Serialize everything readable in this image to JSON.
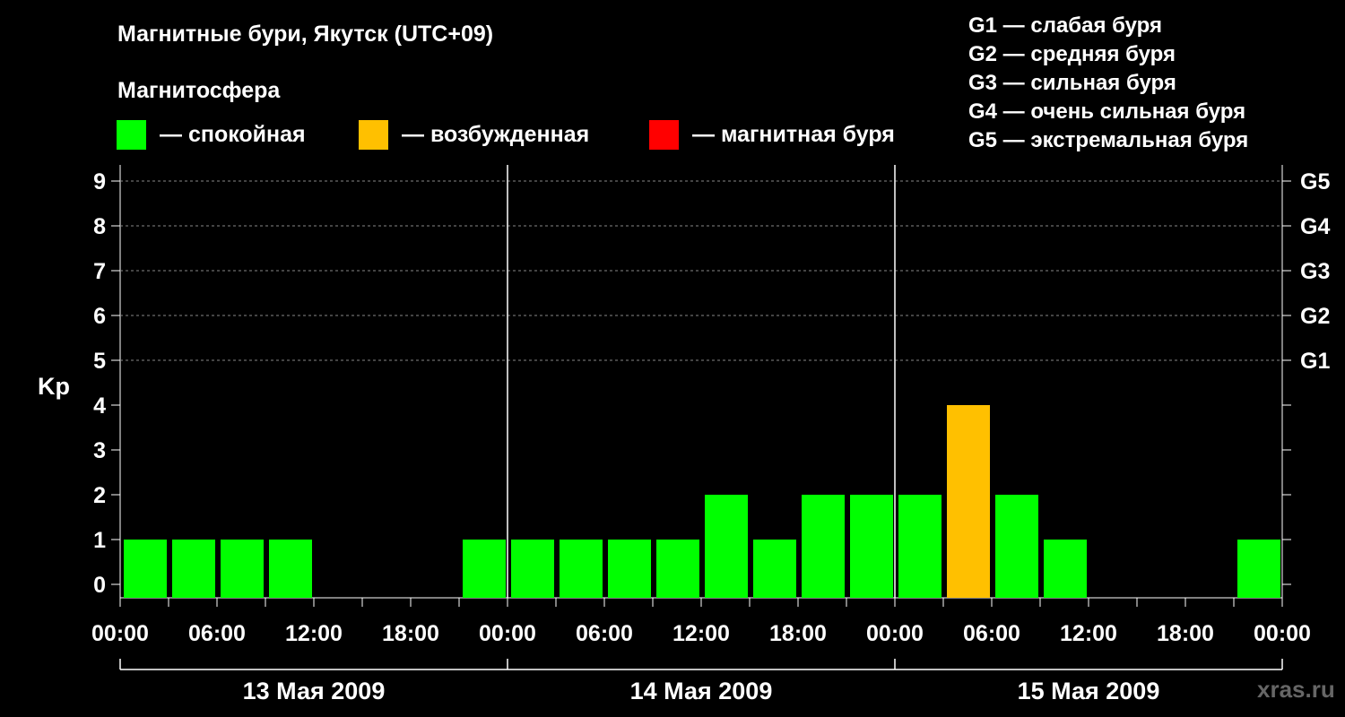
{
  "chart_data": {
    "type": "bar",
    "title": "Магнитные бури, Якутск (UTC+09)",
    "subtitle": "Магнитосфера",
    "ylabel": "Kp",
    "ylim": [
      0,
      9
    ],
    "y_ticks": [
      "0",
      "1",
      "2",
      "3",
      "4",
      "5",
      "6",
      "7",
      "8",
      "9"
    ],
    "g_ticks": [
      {
        "kp": 5,
        "label": "G1"
      },
      {
        "kp": 6,
        "label": "G2"
      },
      {
        "kp": 7,
        "label": "G3"
      },
      {
        "kp": 8,
        "label": "G4"
      },
      {
        "kp": 9,
        "label": "G5"
      }
    ],
    "x_tick_labels": [
      "00:00",
      "06:00",
      "12:00",
      "18:00",
      "00:00",
      "06:00",
      "12:00",
      "18:00",
      "00:00",
      "06:00",
      "12:00",
      "18:00",
      "00:00"
    ],
    "days": [
      "13 Мая 2009",
      "14 Мая 2009",
      "15 Мая 2009"
    ],
    "interval_hours": 3,
    "values": [
      1,
      1,
      1,
      1,
      0,
      0,
      0,
      1,
      1,
      1,
      1,
      1,
      2,
      1,
      2,
      2,
      2,
      4,
      2,
      1,
      0,
      0,
      0,
      1
    ],
    "grid": true,
    "legend": [
      {
        "label": "— спокойная",
        "color": "#00ff00"
      },
      {
        "label": "— возбужденная",
        "color": "#ffc000"
      },
      {
        "label": "— магнитная буря",
        "color": "#ff0000"
      }
    ],
    "scale_legend": [
      "G1 — слабая буря",
      "G2 — средняя буря",
      "G3 — сильная буря",
      "G4 — очень сильная буря",
      "G5 — экстремальная буря"
    ],
    "colors": {
      "quiet": "#00ff00",
      "active": "#ffc000",
      "storm": "#ff0000"
    }
  },
  "watermark": "xras.ru"
}
